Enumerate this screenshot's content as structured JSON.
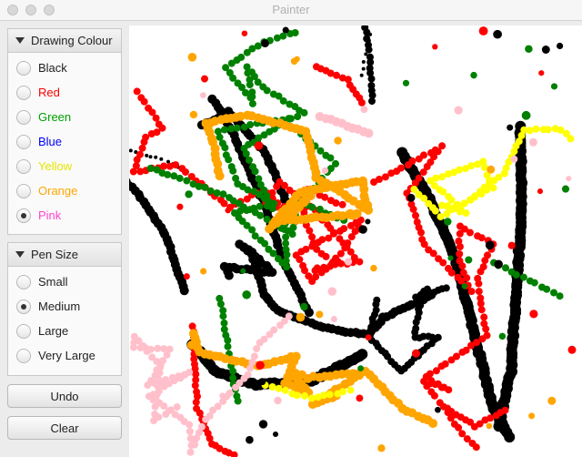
{
  "window": {
    "title": "Painter"
  },
  "colour_panel": {
    "header": "Drawing Colour",
    "options": [
      {
        "label": "Black",
        "color": "#222222",
        "selected": false
      },
      {
        "label": "Red",
        "color": "#ff0000",
        "selected": false
      },
      {
        "label": "Green",
        "color": "#00a000",
        "selected": false
      },
      {
        "label": "Blue",
        "color": "#0000ff",
        "selected": false
      },
      {
        "label": "Yellow",
        "color": "#e6e600",
        "selected": false
      },
      {
        "label": "Orange",
        "color": "#ffa500",
        "selected": false
      },
      {
        "label": "Pink",
        "color": "#ff44cc",
        "selected": true
      }
    ]
  },
  "size_panel": {
    "header": "Pen Size",
    "options": [
      {
        "label": "Small",
        "selected": false
      },
      {
        "label": "Medium",
        "selected": true
      },
      {
        "label": "Large",
        "selected": false
      },
      {
        "label": "Very Large",
        "selected": false
      }
    ]
  },
  "buttons": {
    "undo": "Undo",
    "clear": "Clear"
  },
  "palette": {
    "black": "#000000",
    "red": "#ff0000",
    "green": "#008000",
    "yellow": "#ffff00",
    "orange": "#ffa500",
    "pink": "#ffc0cb"
  }
}
